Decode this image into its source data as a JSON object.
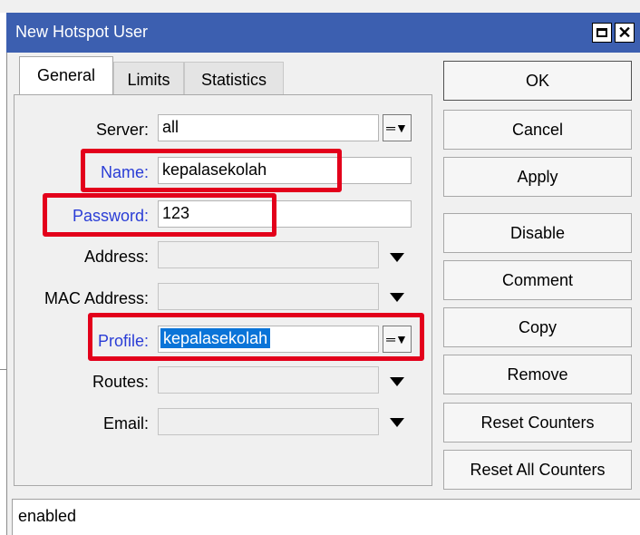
{
  "window": {
    "title": "New Hotspot User"
  },
  "tabs": [
    {
      "label": "General",
      "active": true
    },
    {
      "label": "Limits",
      "active": false
    },
    {
      "label": "Statistics",
      "active": false
    }
  ],
  "fields": {
    "server": {
      "label": "Server:",
      "value": "all"
    },
    "name": {
      "label": "Name:",
      "value": "kepalasekolah"
    },
    "password": {
      "label": "Password:",
      "value": "123"
    },
    "address": {
      "label": "Address:",
      "value": ""
    },
    "mac_address": {
      "label": "MAC Address:",
      "value": ""
    },
    "profile": {
      "label": "Profile:",
      "value": "kepalasekolah"
    },
    "routes": {
      "label": "Routes:",
      "value": ""
    },
    "email": {
      "label": "Email:",
      "value": ""
    }
  },
  "buttons": {
    "ok": "OK",
    "cancel": "Cancel",
    "apply": "Apply",
    "disable": "Disable",
    "comment": "Comment",
    "copy": "Copy",
    "remove": "Remove",
    "reset_counters": "Reset Counters",
    "reset_all_counters": "Reset All Counters"
  },
  "status": {
    "text": "enabled"
  },
  "colors": {
    "titlebar": "#3c5fb0",
    "highlight": "#e3001b",
    "label_link": "#2a3dd6",
    "selection": "#0a74d8"
  }
}
